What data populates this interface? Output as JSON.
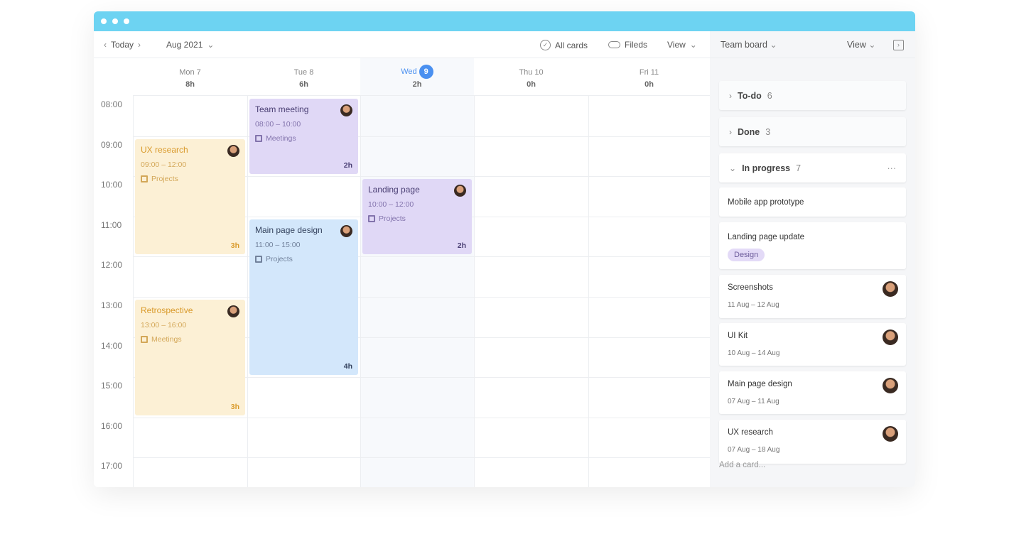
{
  "toolbar": {
    "today": "Today",
    "month": "Aug 2021",
    "all_cards": "All cards",
    "fields": "Fileds",
    "view": "View"
  },
  "days": [
    {
      "label": "Mon 7",
      "hours": "8h"
    },
    {
      "label": "Tue 8",
      "hours": "6h"
    },
    {
      "label": "Wed",
      "num": "9",
      "hours": "2h",
      "today": true
    },
    {
      "label": "Thu 10",
      "hours": "0h"
    },
    {
      "label": "Fri 11",
      "hours": "0h"
    }
  ],
  "times": [
    "08:00",
    "09:00",
    "10:00",
    "11:00",
    "12:00",
    "13:00",
    "14:00",
    "15:00",
    "16:00",
    "17:00"
  ],
  "events": [
    {
      "title": "UX research",
      "time": "09:00 – 12:00",
      "category": "Projects",
      "duration": "3h",
      "day": 0,
      "start": 9,
      "end": 12,
      "color": "yellow"
    },
    {
      "title": "Retrospective",
      "time": "13:00 – 16:00",
      "category": "Meetings",
      "duration": "3h",
      "day": 0,
      "start": 13,
      "end": 16,
      "color": "yellow"
    },
    {
      "title": "Team meeting",
      "time": "08:00 – 10:00",
      "category": "Meetings",
      "duration": "2h",
      "day": 1,
      "start": 8,
      "end": 10,
      "color": "purple"
    },
    {
      "title": "Main page design",
      "time": "11:00 – 15:00",
      "category": "Projects",
      "duration": "4h",
      "day": 1,
      "start": 11,
      "end": 15,
      "color": "blue"
    },
    {
      "title": "Landing page",
      "time": "10:00 – 12:00",
      "category": "Projects",
      "duration": "2h",
      "day": 2,
      "start": 10,
      "end": 12,
      "color": "purple"
    }
  ],
  "colors": {
    "titlebar": "#6dd3f2",
    "today": "#4a90f0",
    "yellow": "#fcf0d5",
    "purple": "#e0d8f6",
    "blue": "#d3e7fb"
  },
  "panel": {
    "title": "Team board",
    "view": "View",
    "add_card": "Add a card...",
    "groups": [
      {
        "label": "To-do",
        "count": "6"
      },
      {
        "label": "Done",
        "count": "3"
      },
      {
        "label": "In progress",
        "count": "7"
      }
    ],
    "cards": [
      {
        "title": "Mobile app prototype"
      },
      {
        "title": "Landing page update",
        "tag": "Design"
      },
      {
        "title": "Screenshots",
        "dates": "11 Aug – 12 Aug"
      },
      {
        "title": "UI Kit",
        "dates": "10 Aug – 14 Aug"
      },
      {
        "title": "Main page design",
        "dates": "07 Aug – 11 Aug"
      },
      {
        "title": "UX research",
        "dates": "07 Aug – 18 Aug"
      }
    ]
  }
}
